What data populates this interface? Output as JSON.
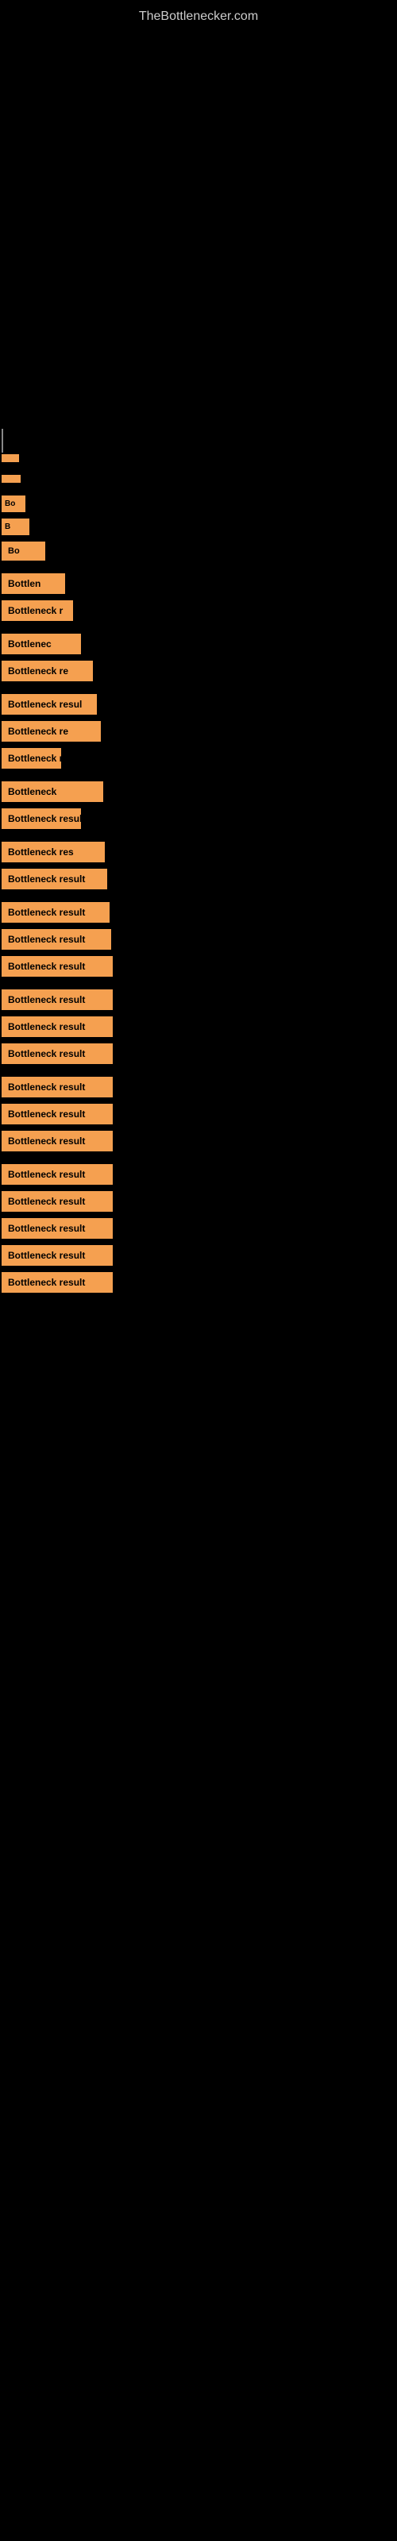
{
  "site": {
    "title": "TheBottlenecker.com"
  },
  "bars": [
    {
      "id": 1,
      "label": "",
      "class": "bar-1"
    },
    {
      "id": 2,
      "label": "",
      "class": "bar-2"
    },
    {
      "id": 3,
      "label": "Bo",
      "class": "bar-3"
    },
    {
      "id": 4,
      "label": "B",
      "class": "bar-4"
    },
    {
      "id": 5,
      "label": "Bo",
      "class": "bar-5"
    },
    {
      "id": 6,
      "label": "Bottlen",
      "class": "bar-6"
    },
    {
      "id": 7,
      "label": "Bottleneck r",
      "class": "bar-7"
    },
    {
      "id": 8,
      "label": "Bottlenec",
      "class": "bar-8"
    },
    {
      "id": 9,
      "label": "Bottleneck re",
      "class": "bar-9"
    },
    {
      "id": 10,
      "label": "Bottleneck resul",
      "class": "bar-10"
    },
    {
      "id": 11,
      "label": "Bottleneck re",
      "class": "bar-11"
    },
    {
      "id": 12,
      "label": "Bottleneck res",
      "class": "bar-12"
    },
    {
      "id": 13,
      "label": "Bottleneck",
      "class": "bar-13"
    },
    {
      "id": 14,
      "label": "Bottleneck result",
      "class": "bar-14"
    },
    {
      "id": 15,
      "label": "Bottleneck res",
      "class": "bar-15"
    },
    {
      "id": 16,
      "label": "Bottleneck result",
      "class": "bar-16"
    },
    {
      "id": 17,
      "label": "Bottleneck result",
      "class": "bar-17"
    },
    {
      "id": 18,
      "label": "Bottleneck result",
      "class": "bar-18"
    },
    {
      "id": 19,
      "label": "Bottleneck result",
      "class": "bar-19"
    },
    {
      "id": 20,
      "label": "Bottleneck result",
      "class": "bar-20"
    },
    {
      "id": 21,
      "label": "Bottleneck result",
      "class": "bar-21"
    },
    {
      "id": 22,
      "label": "Bottleneck result",
      "class": "bar-22"
    },
    {
      "id": 23,
      "label": "Bottleneck result",
      "class": "bar-23"
    },
    {
      "id": 24,
      "label": "Bottleneck result",
      "class": "bar-24"
    },
    {
      "id": 25,
      "label": "Bottleneck result",
      "class": "bar-25"
    },
    {
      "id": 26,
      "label": "Bottleneck result",
      "class": "bar-26"
    },
    {
      "id": 27,
      "label": "Bottleneck result",
      "class": "bar-27"
    },
    {
      "id": 28,
      "label": "Bottleneck result",
      "class": "bar-28"
    },
    {
      "id": 29,
      "label": "Bottleneck result",
      "class": "bar-29"
    },
    {
      "id": 30,
      "label": "Bottleneck result",
      "class": "bar-30"
    }
  ]
}
